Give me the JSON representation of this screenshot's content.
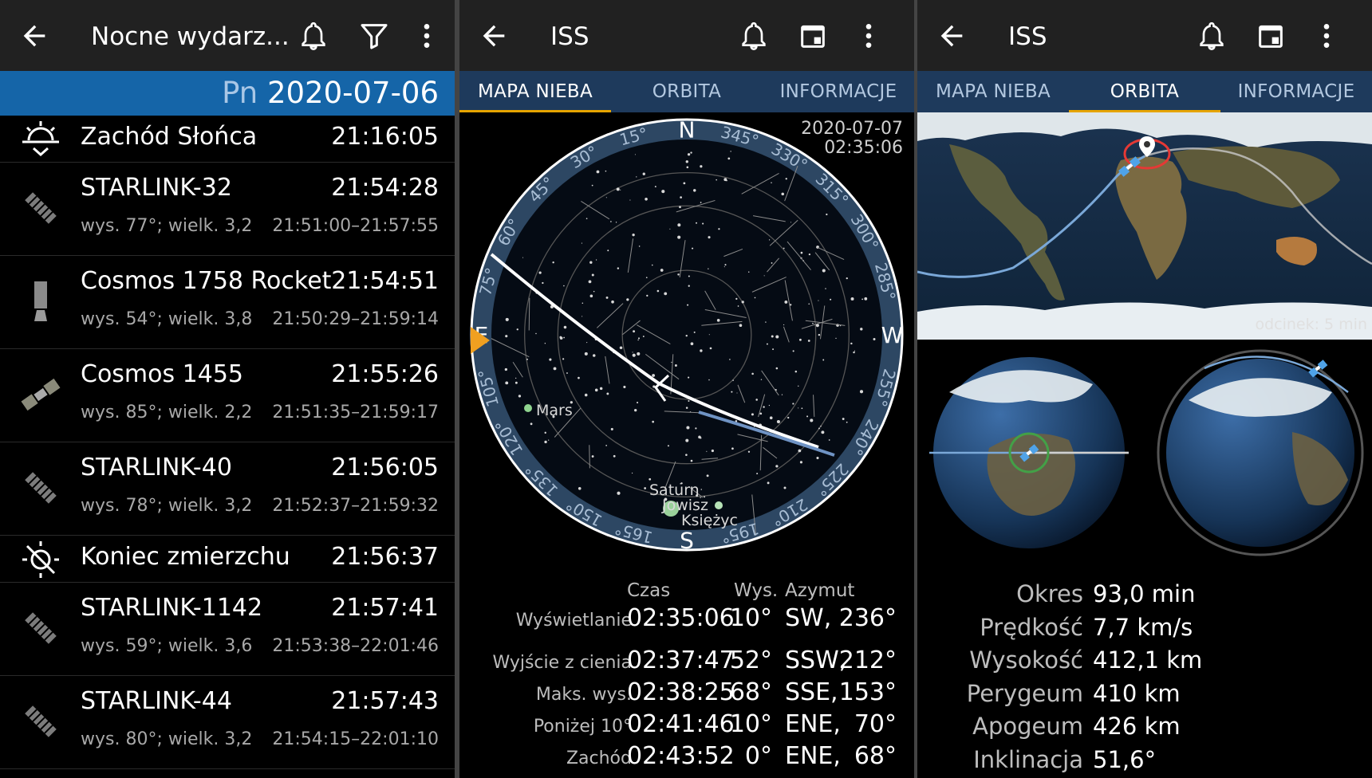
{
  "panel1": {
    "title": "Nocne wydarz...",
    "icons": [
      "back-arrow-icon",
      "bell-icon",
      "filter-icon",
      "more-vert-icon"
    ],
    "date_day": "Pn",
    "date": "2020-07-06",
    "events": [
      {
        "type": "sunset",
        "name": "Zachód Słońca",
        "time": "21:16:05"
      },
      {
        "type": "satellite",
        "name": "STARLINK-32",
        "time": "21:54:28",
        "sub": "wys. 77°; wielk. 3,2",
        "range": "21:51:00–21:57:55"
      },
      {
        "type": "rocket",
        "name": "Cosmos 1758 Rocket",
        "time": "21:54:51",
        "sub": "wys. 54°; wielk. 3,8",
        "range": "21:50:29–21:59:14"
      },
      {
        "type": "satellite2",
        "name": "Cosmos 1455",
        "time": "21:55:26",
        "sub": "wys. 85°; wielk. 2,2",
        "range": "21:51:35–21:59:17"
      },
      {
        "type": "satellite",
        "name": "STARLINK-40",
        "time": "21:56:05",
        "sub": "wys. 78°; wielk. 3,2",
        "range": "21:52:37–21:59:32"
      },
      {
        "type": "twilight",
        "name": "Koniec zmierzchu",
        "time": "21:56:37"
      },
      {
        "type": "satellite",
        "name": "STARLINK-1142",
        "time": "21:57:41",
        "sub": "wys. 59°; wielk. 3,6",
        "range": "21:53:38–22:01:46"
      },
      {
        "type": "satellite",
        "name": "STARLINK-44",
        "time": "21:57:43",
        "sub": "wys. 80°; wielk. 3,2",
        "range": "21:54:15–22:01:10"
      }
    ]
  },
  "panel2": {
    "title": "ISS",
    "tabs": [
      "MAPA NIEBA",
      "ORBITA",
      "INFORMACJE"
    ],
    "active_tab": 0,
    "sky_date": "2020-07-07",
    "sky_time": "02:35:06",
    "cardinals": {
      "n": "N",
      "e": "E",
      "s": "S",
      "w": "W"
    },
    "ring_labels": [
      "15°",
      "30°",
      "45°",
      "60°",
      "75°",
      "105°",
      "120°",
      "135°",
      "150°",
      "165°",
      "195°",
      "210°",
      "225°",
      "240°",
      "255°",
      "285°",
      "300°",
      "315°",
      "330°",
      "345°"
    ],
    "bodies": {
      "mars": "Mars",
      "saturn": "Saturn",
      "jupiter": "Jowisz",
      "moon": "Księżyc"
    },
    "table_headers": {
      "time": "Czas",
      "alt": "Wys.",
      "azimuth": "Azymut"
    },
    "passes": [
      {
        "label": "Wyświetlanie",
        "time": "02:35:06",
        "alt": "10°",
        "dir": "SW,",
        "az": "236°"
      },
      {
        "label": "Wyjście z cienia",
        "time": "02:37:47",
        "alt": "52°",
        "dir": "SSW,",
        "az": "212°"
      },
      {
        "label": "Maks. wys.",
        "time": "02:38:25",
        "alt": "68°",
        "dir": "SSE,",
        "az": "153°"
      },
      {
        "label": "Poniżej 10°",
        "time": "02:41:46",
        "alt": "10°",
        "dir": "ENE,",
        "az": "70°"
      },
      {
        "label": "Zachód",
        "time": "02:43:52",
        "alt": "0°",
        "dir": "ENE,",
        "az": "68°"
      }
    ]
  },
  "panel3": {
    "title": "ISS",
    "tabs": [
      "MAPA NIEBA",
      "ORBITA",
      "INFORMACJE"
    ],
    "active_tab": 1,
    "map_label": "odcinek: 5 min",
    "orbit": [
      {
        "k": "Okres",
        "v": "93,0 min"
      },
      {
        "k": "Prędkość",
        "v": "7,7 km/s"
      },
      {
        "k": "Wysokość",
        "v": "412,1 km"
      },
      {
        "k": "Perygeum",
        "v": "410 km"
      },
      {
        "k": "Apogeum",
        "v": "426 km"
      },
      {
        "k": "Inklinacja",
        "v": "51,6°"
      }
    ]
  },
  "colors": {
    "appbar": "#212121",
    "tabbar": "#1e3a5c",
    "datebar": "#1565a8",
    "tab_indicator": "#e6a400",
    "sky_ring": "#2d4763",
    "orbit_path": "#ffffff"
  }
}
